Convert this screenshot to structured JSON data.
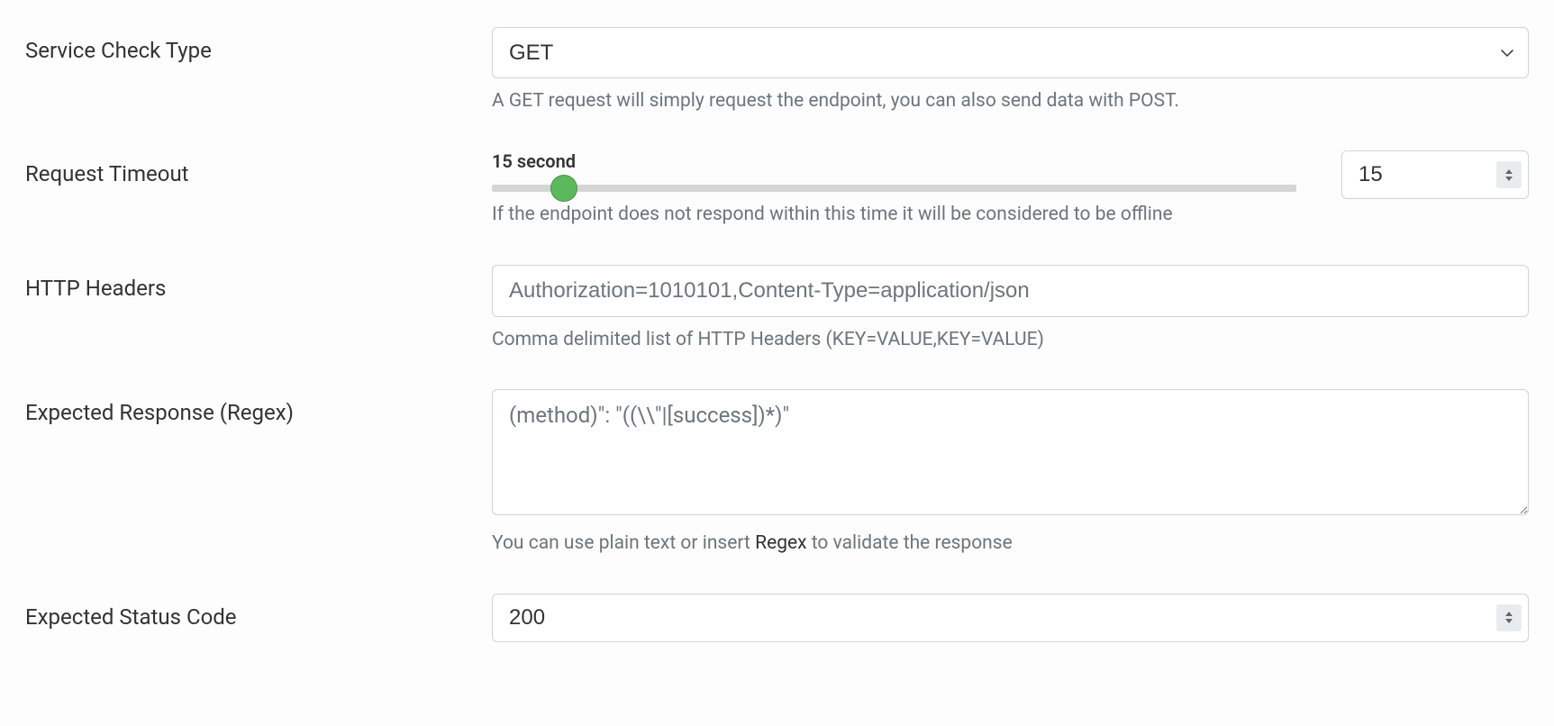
{
  "fields": {
    "service_check_type": {
      "label": "Service Check Type",
      "value": "GET",
      "help": "A GET request will simply request the endpoint, you can also send data with POST."
    },
    "request_timeout": {
      "label": "Request Timeout",
      "slider_label": "15 second",
      "value": "15",
      "slider_percent": 9,
      "help": "If the endpoint does not respond within this time it will be considered to be offline"
    },
    "http_headers": {
      "label": "HTTP Headers",
      "placeholder": "Authorization=1010101,Content-Type=application/json",
      "help": "Comma delimited list of HTTP Headers (KEY=VALUE,KEY=VALUE)"
    },
    "expected_response": {
      "label": "Expected Response (Regex)",
      "placeholder": "(method)\": \"((\\\\\"|[success])*)\"",
      "help_before": "You can use plain text or insert ",
      "help_link": "Regex",
      "help_after": " to validate the response"
    },
    "expected_status_code": {
      "label": "Expected Status Code",
      "value": "200"
    }
  }
}
